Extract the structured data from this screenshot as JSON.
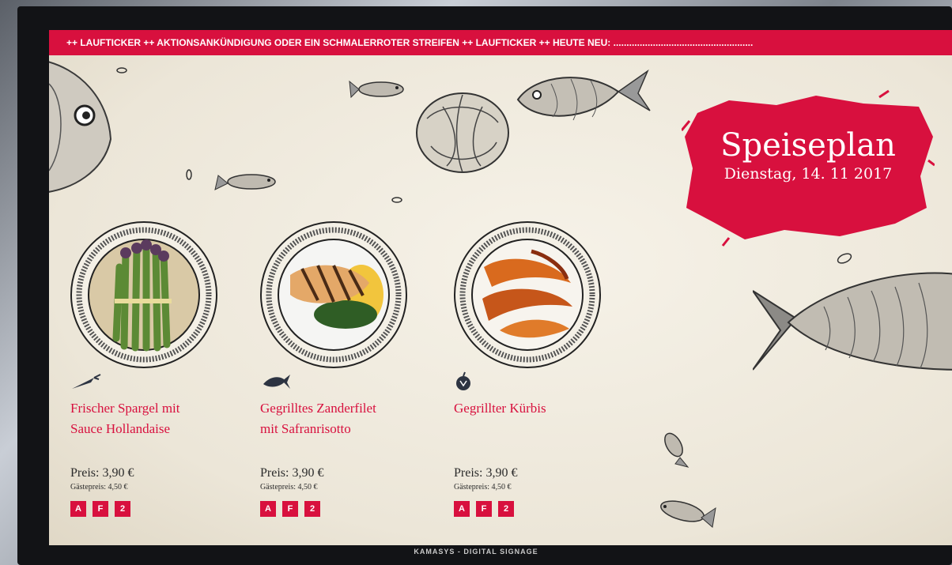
{
  "ticker": {
    "text": "++ LAUFTICKER ++  AKTIONSANKÜNDIGUNG ODER EIN SCHMALERROTER STREIFEN  ++ LAUFTICKER ++  HEUTE NEU:  ....................................................."
  },
  "header": {
    "title": "Speiseplan",
    "date": "Dienstag, 14. 11 2017"
  },
  "dishes": [
    {
      "name_line1": "Frischer Spargel mit",
      "name_line2": "Sauce Hollandaise",
      "price": "Preis: 3,90 €",
      "guest_price": "Gästepreis: 4,50 €",
      "type_icon": "carrot-icon",
      "image": "asparagus",
      "allergens": [
        "A",
        "F",
        "2"
      ]
    },
    {
      "name_line1": "Gegrilltes Zanderfilet",
      "name_line2": "mit Safranrisotto",
      "price": "Preis: 3,90 €",
      "guest_price": "Gästepreis: 4,50 €",
      "type_icon": "fish-icon",
      "image": "grilled-fish",
      "allergens": [
        "A",
        "F",
        "2"
      ]
    },
    {
      "name_line1": "Gegrillter Kürbis",
      "name_line2": "",
      "price": "Preis: 3,90 €",
      "guest_price": "Gästepreis: 4,50 €",
      "type_icon": "apple-icon",
      "image": "pumpkin",
      "allergens": [
        "A",
        "F",
        "2"
      ]
    }
  ],
  "footer": {
    "label": "KAMASYS - DIGITAL SIGNAGE"
  },
  "colors": {
    "accent": "#d8103e",
    "background": "#f1ece2",
    "ink": "#2b2b2b"
  }
}
